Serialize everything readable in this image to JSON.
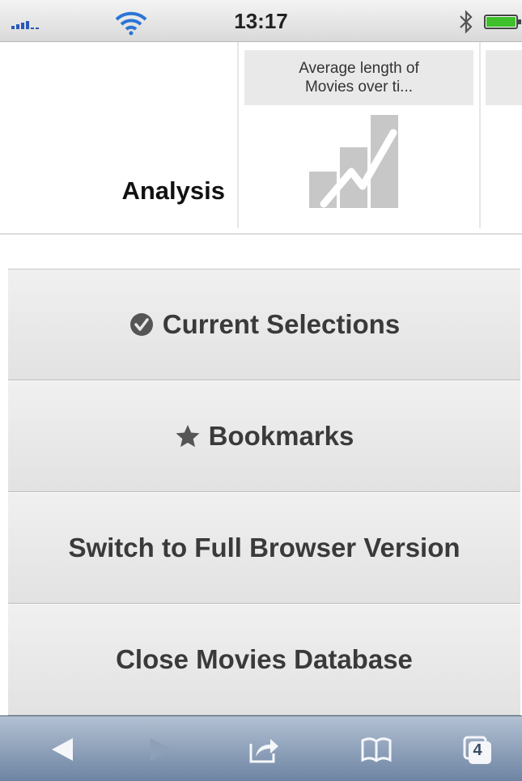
{
  "status_bar": {
    "time": "13:17",
    "icons": [
      "signal-icon",
      "wifi-icon",
      "bluetooth-icon",
      "battery-icon"
    ]
  },
  "analysis": {
    "label": "Analysis",
    "thumbnails": [
      {
        "title": "Average length of\nMovies over ti...",
        "icon": "line-chart-icon"
      }
    ]
  },
  "menu": {
    "items": [
      {
        "label": "Current Selections",
        "icon": "checkmark-circle-icon"
      },
      {
        "label": "Bookmarks",
        "icon": "star-icon"
      },
      {
        "label": "Switch to Full Browser Version"
      },
      {
        "label": "Close Movies Database"
      }
    ]
  },
  "toolbar": {
    "tab_count": "4",
    "buttons": [
      "back-icon",
      "forward-icon",
      "share-icon",
      "bookmarks-book-icon",
      "tabs-icon"
    ]
  },
  "colors": {
    "toolbar_top": "#b3c1d3",
    "toolbar_bottom": "#6d84a3",
    "battery_green": "#3fbf2a"
  }
}
